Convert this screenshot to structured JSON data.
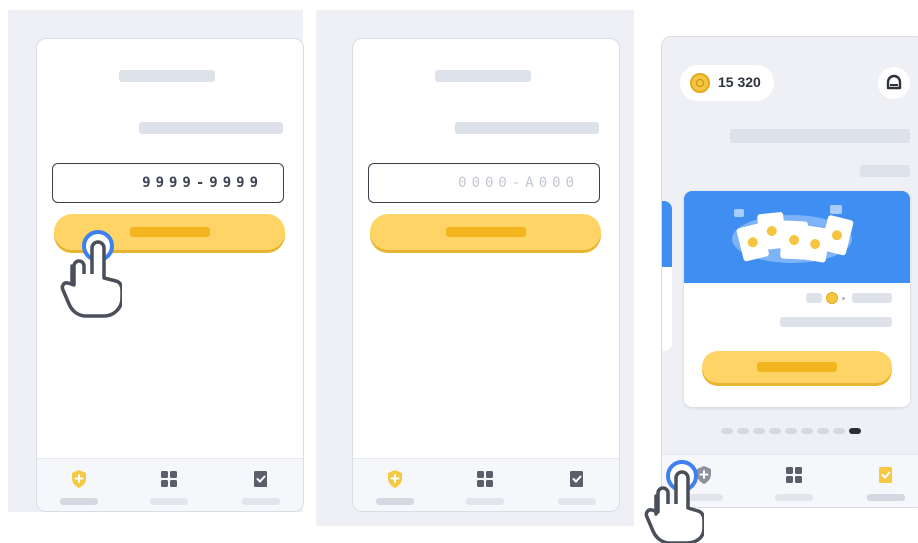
{
  "step1": {
    "code_value": "9999-9999"
  },
  "step2": {
    "code_placeholder": "0000-A000"
  },
  "step3": {
    "coin_count": "15 320",
    "carousel_pages": 9,
    "carousel_active": 8
  },
  "icons": {
    "tab_learn": "shield-plus-icon",
    "tab_grid": "grid-icon",
    "tab_tasks": "clipboard-check-icon",
    "coin": "coin-icon",
    "avatar": "user-icon",
    "pointer": "hand-pointer-icon"
  },
  "colors": {
    "accent_yellow": "#ffd466",
    "accent_yellow_dark": "#f2b520",
    "banner_blue": "#3f8ef2",
    "tap_ring": "#3e7ff1",
    "skeleton": "#dde1ea"
  }
}
